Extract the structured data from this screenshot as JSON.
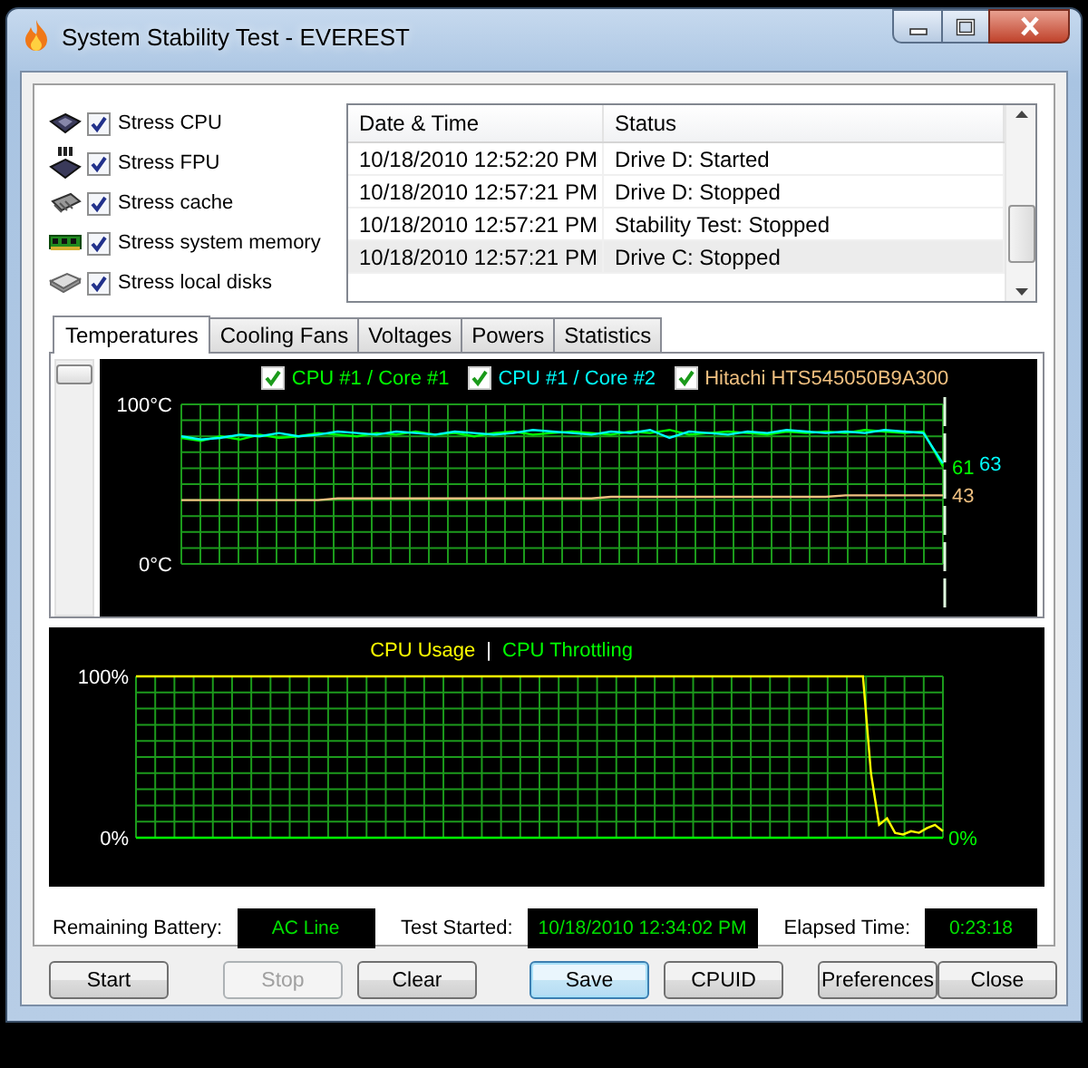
{
  "window": {
    "title": "System Stability Test - EVEREST"
  },
  "stress_options": [
    {
      "label": "Stress CPU",
      "kind": "cpu",
      "checked": true
    },
    {
      "label": "Stress FPU",
      "kind": "fpu",
      "checked": true
    },
    {
      "label": "Stress cache",
      "kind": "cache",
      "checked": true
    },
    {
      "label": "Stress system memory",
      "kind": "memory",
      "checked": true
    },
    {
      "label": "Stress local disks",
      "kind": "disk",
      "checked": true
    }
  ],
  "log": {
    "columns": [
      "Date & Time",
      "Status"
    ],
    "rows": [
      {
        "date_time": "10/18/2010 12:52:20 PM",
        "status": "Drive D: Started",
        "selected": false
      },
      {
        "date_time": "10/18/2010 12:57:21 PM",
        "status": "Drive D: Stopped",
        "selected": false
      },
      {
        "date_time": "10/18/2010 12:57:21 PM",
        "status": "Stability Test: Stopped",
        "selected": false
      },
      {
        "date_time": "10/18/2010 12:57:21 PM",
        "status": "Drive C: Stopped",
        "selected": true
      }
    ]
  },
  "tabs": [
    {
      "label": "Temperatures",
      "selected": true
    },
    {
      "label": "Cooling Fans",
      "selected": false
    },
    {
      "label": "Voltages",
      "selected": false
    },
    {
      "label": "Powers",
      "selected": false
    },
    {
      "label": "Statistics",
      "selected": false
    }
  ],
  "temperature_chart": {
    "legend": [
      {
        "checked": true
      },
      {
        "checked": true
      },
      {
        "checked": true
      }
    ],
    "readings": [
      {
        "text": "61",
        "color": "#00ff00"
      },
      {
        "text": "63",
        "color": "#00ffff"
      },
      {
        "text": "43",
        "color": "#f0c080"
      }
    ],
    "chart_data": {
      "type": "line",
      "grid": true,
      "ylim": [
        0,
        100
      ],
      "yticks": [
        {
          "value": 0,
          "label": "0°C"
        },
        {
          "value": 100,
          "label": "100°C"
        }
      ],
      "series": [
        {
          "name": "CPU #1 / Core #1",
          "color": "#00ff00",
          "values": [
            79,
            77,
            80,
            78,
            81,
            79,
            80,
            82,
            81,
            80,
            82,
            81,
            83,
            81,
            82,
            80,
            82,
            83,
            81,
            82,
            83,
            82,
            81,
            83,
            82,
            84,
            81,
            82,
            83,
            82,
            81,
            83,
            82,
            83,
            82,
            84,
            83,
            82,
            83,
            61
          ]
        },
        {
          "name": "CPU #1 / Core #2",
          "color": "#00ffff",
          "values": [
            80,
            78,
            79,
            81,
            80,
            82,
            80,
            81,
            83,
            82,
            81,
            83,
            82,
            81,
            83,
            82,
            81,
            82,
            84,
            83,
            82,
            81,
            83,
            82,
            84,
            79,
            83,
            82,
            81,
            83,
            82,
            84,
            83,
            82,
            83,
            82,
            84,
            83,
            82,
            63
          ]
        },
        {
          "name": "Hitachi HTS545050B9A300",
          "color": "#f0c080",
          "values": [
            40,
            40,
            40,
            40,
            40,
            40,
            40,
            40,
            41,
            41,
            41,
            41,
            41,
            41,
            41,
            41,
            41,
            41,
            41,
            41,
            41,
            41,
            42,
            42,
            42,
            42,
            42,
            42,
            42,
            42,
            42,
            42,
            42,
            42,
            43,
            43,
            43,
            43,
            43,
            43
          ]
        }
      ]
    }
  },
  "cpu_chart": {
    "separator": "|",
    "readings": [
      {
        "text": "0%",
        "color": "#00ff00"
      }
    ],
    "chart_data": {
      "type": "line",
      "grid": true,
      "ylim": [
        0,
        100
      ],
      "yticks": [
        {
          "value": 0,
          "label": "0%"
        },
        {
          "value": 100,
          "label": "100%"
        }
      ],
      "series": [
        {
          "name": "CPU Usage",
          "color": "#ffff00",
          "values": [
            100,
            100,
            100,
            100,
            100,
            100,
            100,
            100,
            100,
            100,
            100,
            100,
            100,
            100,
            100,
            100,
            100,
            100,
            100,
            100,
            100,
            100,
            100,
            100,
            100,
            100,
            100,
            100,
            100,
            100,
            100,
            100,
            100,
            100,
            100,
            100,
            100,
            100,
            100,
            100,
            100,
            100,
            100,
            100,
            100,
            100,
            100,
            100,
            100,
            100,
            100,
            100,
            100,
            100,
            100,
            100,
            100,
            100,
            100,
            100,
            100,
            100,
            100,
            100,
            100,
            100,
            100,
            100,
            100,
            100,
            100,
            100,
            100,
            100,
            100,
            100,
            100,
            100,
            100,
            100,
            100,
            100,
            100,
            100,
            100,
            100,
            100,
            100,
            100,
            100,
            100,
            100,
            40,
            8,
            12,
            3,
            2,
            4,
            3,
            6,
            8,
            4
          ]
        },
        {
          "name": "CPU Throttling",
          "color": "#00ff00",
          "values": [
            0,
            0,
            0,
            0,
            0,
            0,
            0,
            0,
            0,
            0,
            0,
            0,
            0,
            0,
            0,
            0,
            0,
            0,
            0,
            0,
            0,
            0,
            0,
            0,
            0,
            0,
            0,
            0,
            0,
            0,
            0,
            0,
            0,
            0,
            0,
            0,
            0,
            0,
            0,
            0,
            0,
            0,
            0,
            0,
            0,
            0,
            0,
            0,
            0,
            0,
            0,
            0,
            0,
            0,
            0,
            0,
            0,
            0,
            0,
            0,
            0,
            0,
            0,
            0,
            0,
            0,
            0,
            0,
            0,
            0,
            0,
            0,
            0,
            0,
            0,
            0,
            0,
            0,
            0,
            0,
            0,
            0,
            0,
            0,
            0,
            0,
            0,
            0,
            0,
            0,
            0,
            0,
            0,
            0,
            0,
            0,
            0,
            0,
            0,
            0,
            0,
            0
          ]
        }
      ]
    }
  },
  "info": [
    {
      "label": "Remaining Battery:",
      "value": "AC Line"
    },
    {
      "label": "Test Started:",
      "value": "10/18/2010 12:34:02 PM"
    },
    {
      "label": "Elapsed Time:",
      "value": "0:23:18"
    }
  ],
  "buttons": [
    {
      "label": "Start",
      "disabled": false,
      "default": false
    },
    {
      "label": "Stop",
      "disabled": true,
      "default": false
    },
    {
      "label": "Clear",
      "disabled": false,
      "default": false
    },
    {
      "label": "Save",
      "disabled": false,
      "default": true
    },
    {
      "label": "CPUID",
      "disabled": false,
      "default": false
    },
    {
      "label": "Preferences",
      "disabled": false,
      "default": false
    },
    {
      "label": "Close",
      "disabled": false,
      "default": false
    }
  ]
}
